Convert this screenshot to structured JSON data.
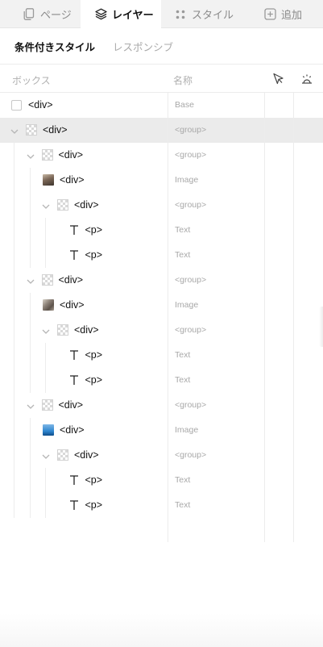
{
  "tabs": [
    {
      "label": "ページ",
      "icon": "page-icon",
      "active": false
    },
    {
      "label": "レイヤー",
      "icon": "layers-icon",
      "active": true
    },
    {
      "label": "スタイル",
      "icon": "style-grid-icon",
      "active": false
    },
    {
      "label": "追加",
      "icon": "add-square-icon",
      "active": false
    }
  ],
  "subtabs": [
    {
      "label": "条件付きスタイル",
      "active": true
    },
    {
      "label": "レスポンシブ",
      "active": false
    }
  ],
  "header": {
    "box_label": "ボックス",
    "name_label": "名称",
    "col3_icon": "cursor-pointer-icon",
    "col4_icon": "visibility-sun-icon"
  },
  "tree": [
    {
      "depth": 0,
      "tag": "<div>",
      "name": "Base",
      "kind": "checkbox",
      "expanded": null,
      "selected": false
    },
    {
      "depth": 0,
      "tag": "<div>",
      "name": "<group>",
      "kind": "group",
      "expanded": true,
      "selected": true
    },
    {
      "depth": 1,
      "tag": "<div>",
      "name": "<group>",
      "kind": "group",
      "expanded": true,
      "selected": false
    },
    {
      "depth": 2,
      "tag": "<div>",
      "name": "Image",
      "kind": "image1",
      "expanded": null,
      "selected": false
    },
    {
      "depth": 2,
      "tag": "<div>",
      "name": "<group>",
      "kind": "group",
      "expanded": true,
      "selected": false
    },
    {
      "depth": 3,
      "tag": "<p>",
      "name": "Text",
      "kind": "text",
      "expanded": null,
      "selected": false
    },
    {
      "depth": 3,
      "tag": "<p>",
      "name": "Text",
      "kind": "text",
      "expanded": null,
      "selected": false
    },
    {
      "depth": 1,
      "tag": "<div>",
      "name": "<group>",
      "kind": "group",
      "expanded": true,
      "selected": false
    },
    {
      "depth": 2,
      "tag": "<div>",
      "name": "Image",
      "kind": "image2",
      "expanded": null,
      "selected": false
    },
    {
      "depth": 2,
      "tag": "<div>",
      "name": "<group>",
      "kind": "group",
      "expanded": true,
      "selected": false
    },
    {
      "depth": 3,
      "tag": "<p>",
      "name": "Text",
      "kind": "text",
      "expanded": null,
      "selected": false
    },
    {
      "depth": 3,
      "tag": "<p>",
      "name": "Text",
      "kind": "text",
      "expanded": null,
      "selected": false
    },
    {
      "depth": 1,
      "tag": "<div>",
      "name": "<group>",
      "kind": "group",
      "expanded": true,
      "selected": false
    },
    {
      "depth": 2,
      "tag": "<div>",
      "name": "Image",
      "kind": "image3",
      "expanded": null,
      "selected": false
    },
    {
      "depth": 2,
      "tag": "<div>",
      "name": "<group>",
      "kind": "group",
      "expanded": true,
      "selected": false
    },
    {
      "depth": 3,
      "tag": "<p>",
      "name": "Text",
      "kind": "text",
      "expanded": null,
      "selected": false
    },
    {
      "depth": 3,
      "tag": "<p>",
      "name": "Text",
      "kind": "text",
      "expanded": null,
      "selected": false
    }
  ],
  "colors": {
    "selected_row": "#ebebeb",
    "tab_bar": "#f2f2f2",
    "muted_text": "#a8a8a8"
  }
}
